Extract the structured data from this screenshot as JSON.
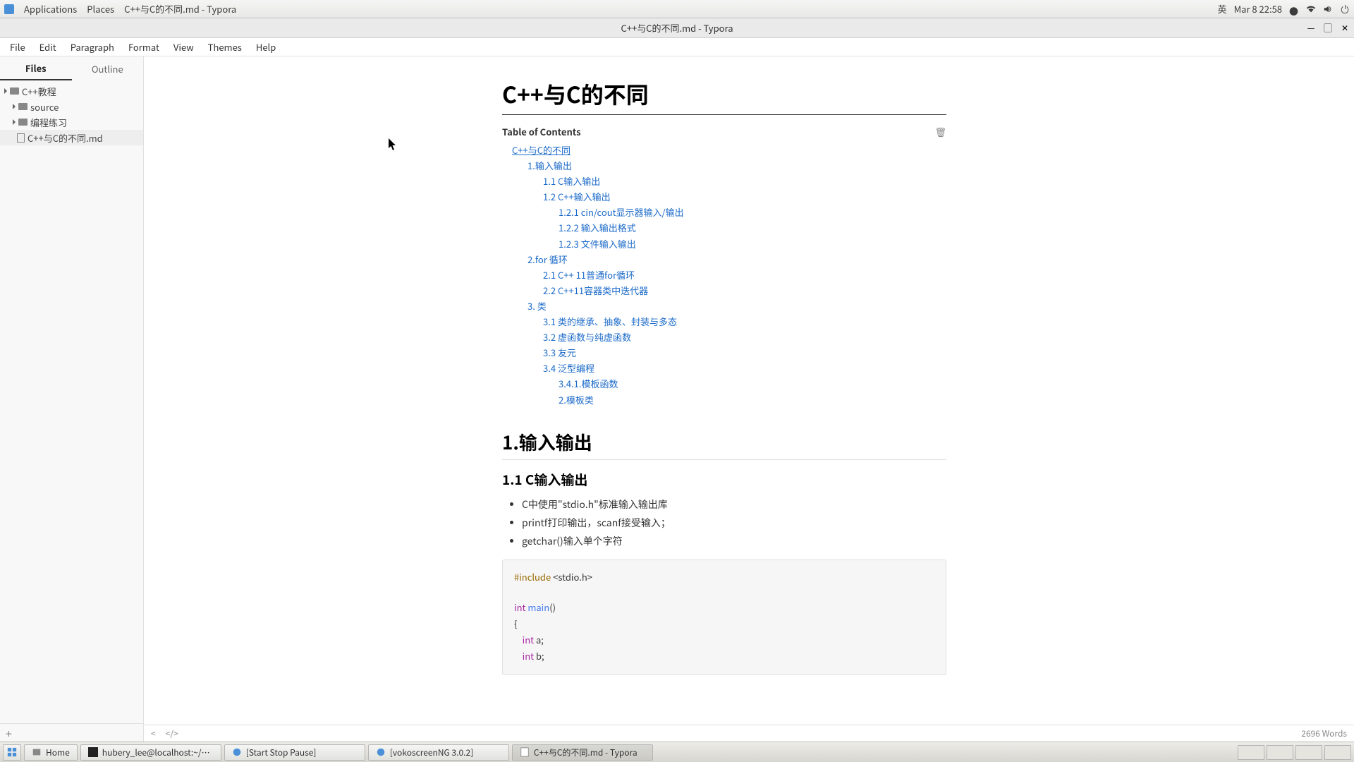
{
  "panel": {
    "applications": "Applications",
    "places": "Places",
    "title": "C++与C的不同.md - Typora",
    "ime": "英",
    "clock": "Mar 8  22:58"
  },
  "win": {
    "title": "C++与C的不同.md - Typora"
  },
  "menu": {
    "file": "File",
    "edit": "Edit",
    "paragraph": "Paragraph",
    "format": "Format",
    "view": "View",
    "themes": "Themes",
    "help": "Help"
  },
  "sidebar": {
    "tabs": {
      "files": "Files",
      "outline": "Outline"
    },
    "tree": [
      {
        "label": "C++教程"
      },
      {
        "label": "source"
      },
      {
        "label": "编程练习"
      },
      {
        "label": "C++与C的不同.md"
      }
    ]
  },
  "doc": {
    "title": "C++与C的不同",
    "toc_header": "Table of Contents",
    "toc": [
      {
        "lvl": 0,
        "text": "C++与C的不同"
      },
      {
        "lvl": 1,
        "text": "1.输入输出"
      },
      {
        "lvl": 2,
        "text": "1.1 C输入输出"
      },
      {
        "lvl": 2,
        "text": "1.2 C++输入输出"
      },
      {
        "lvl": 3,
        "text": "1.2.1 cin/cout显示器输入/输出"
      },
      {
        "lvl": 3,
        "text": "1.2.2 输入输出格式"
      },
      {
        "lvl": 3,
        "text": "1.2.3 文件输入输出"
      },
      {
        "lvl": 1,
        "text": "2.for 循环"
      },
      {
        "lvl": 2,
        "text": "2.1 C++ 11普通for循环"
      },
      {
        "lvl": 2,
        "text": "2.2 C++11容器类中迭代器"
      },
      {
        "lvl": 1,
        "text": "3. 类"
      },
      {
        "lvl": 2,
        "text": "3.1 类的继承、抽象、封装与多态"
      },
      {
        "lvl": 2,
        "text": "3.2 虚函数与纯虚函数"
      },
      {
        "lvl": 2,
        "text": "3.3 友元"
      },
      {
        "lvl": 2,
        "text": "3.4 泛型编程"
      },
      {
        "lvl": 3,
        "text": "3.4.1.模板函数"
      },
      {
        "lvl": 3,
        "text": "2.模板类"
      }
    ],
    "h2_1": "1.输入输出",
    "h3_11": "1.1 C输入输出",
    "bullets": [
      "C中使用\"stdio.h\"标准输入输出库",
      "printf打印输出，scanf接受输入；",
      "getchar()输入单个字符"
    ],
    "code": {
      "l1_pp": "#include",
      "l1_rest": " <stdio.h>",
      "l2_kw": "int",
      "l2_fn": " main",
      "l2_rest": "()",
      "l3": "{",
      "l4_pad": "    ",
      "l4_kw": "int",
      "l4_rest": " a;",
      "l5_pad": "    ",
      "l5_kw": "int",
      "l5_rest": " b;"
    }
  },
  "status": {
    "words": "2696 Words"
  },
  "taskbar": {
    "home": "Home",
    "term": "hubery_lee@localhost:~/Typora-linu...",
    "voko1": "[Start Stop Pause]",
    "voko2": "[vokoscreenNG 3.0.2]",
    "typora": "C++与C的不同.md - Typora"
  }
}
